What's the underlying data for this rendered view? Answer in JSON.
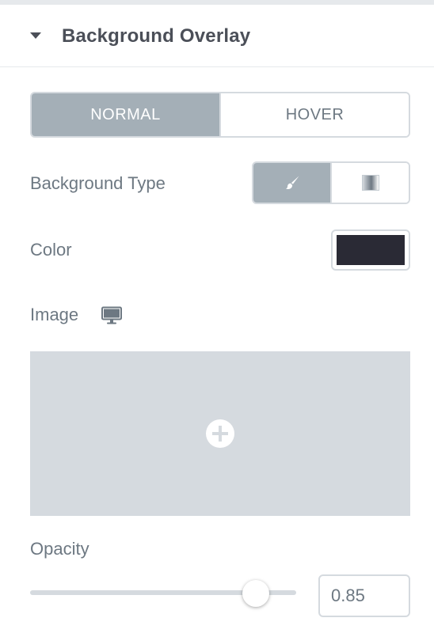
{
  "section": {
    "title": "Background Overlay",
    "expanded": true
  },
  "state_tabs": [
    {
      "label": "NORMAL",
      "active": true
    },
    {
      "label": "HOVER",
      "active": false
    }
  ],
  "background_type": {
    "label": "Background Type",
    "options": [
      {
        "name": "classic",
        "icon": "brush-icon",
        "active": true
      },
      {
        "name": "gradient",
        "icon": "gradient-icon",
        "active": false
      }
    ]
  },
  "color": {
    "label": "Color",
    "value": "#2a2a35"
  },
  "image": {
    "label": "Image",
    "responsive_icon": "desktop-icon",
    "add_icon": "plus-icon"
  },
  "opacity": {
    "label": "Opacity",
    "value": "0.85",
    "slider_fraction": 0.85
  },
  "colors": {
    "accent_active": "#a4afb7",
    "border": "#d5dadf",
    "text": "#6d7882",
    "heading": "#4b4f58"
  }
}
